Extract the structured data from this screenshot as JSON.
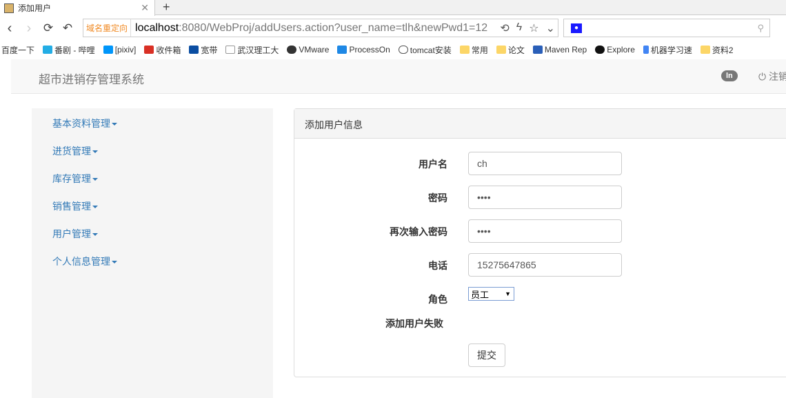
{
  "browser": {
    "tab_title": "添加用户",
    "redirect_label": "域名重定向",
    "url_host": "localhost",
    "url_rest": ":8080/WebProj/addUsers.action?user_name=tlh&newPwd1=12",
    "bookmarks": [
      {
        "label": "百度一下",
        "color": "#fff"
      },
      {
        "label": "番剧 - 哔哩",
        "color": "#23ade5"
      },
      {
        "label": "[pixiv]",
        "color": "#0096fa"
      },
      {
        "label": "收件箱",
        "color": "#d93025"
      },
      {
        "label": "宽带",
        "color": "#0b4ea2"
      },
      {
        "label": "武汉理工大",
        "color": "#ddd"
      },
      {
        "label": "VMware",
        "color": "#333"
      },
      {
        "label": "ProcessOn",
        "color": "#1e88e5"
      },
      {
        "label": "tomcat安装",
        "color": "#555"
      },
      {
        "label": "常用",
        "color": "#fcd667"
      },
      {
        "label": "论文",
        "color": "#fcd667"
      },
      {
        "label": "Maven Rep",
        "color": "#2a5fb8"
      },
      {
        "label": "Explore",
        "color": "#111"
      },
      {
        "label": "机器学习速",
        "color": "#4285f4"
      },
      {
        "label": "资料2",
        "color": "#fcd667"
      }
    ]
  },
  "header": {
    "brand": "超市进销存管理系统",
    "badge": "ln",
    "logout": "注销"
  },
  "sidebar": {
    "items": [
      {
        "label": "基本资料管理"
      },
      {
        "label": "进货管理"
      },
      {
        "label": "库存管理"
      },
      {
        "label": "销售管理"
      },
      {
        "label": "用户管理"
      },
      {
        "label": "个人信息管理"
      }
    ]
  },
  "form": {
    "title": "添加用户信息",
    "username_label": "用户名",
    "username_value": "ch",
    "password_label": "密码",
    "password_value": "••••",
    "password2_label": "再次输入密码",
    "password2_value": "••••",
    "phone_label": "电话",
    "phone_value": "15275647865",
    "role_label": "角色",
    "role_value": "员工",
    "error_message": "添加用户失败",
    "submit": "提交"
  }
}
